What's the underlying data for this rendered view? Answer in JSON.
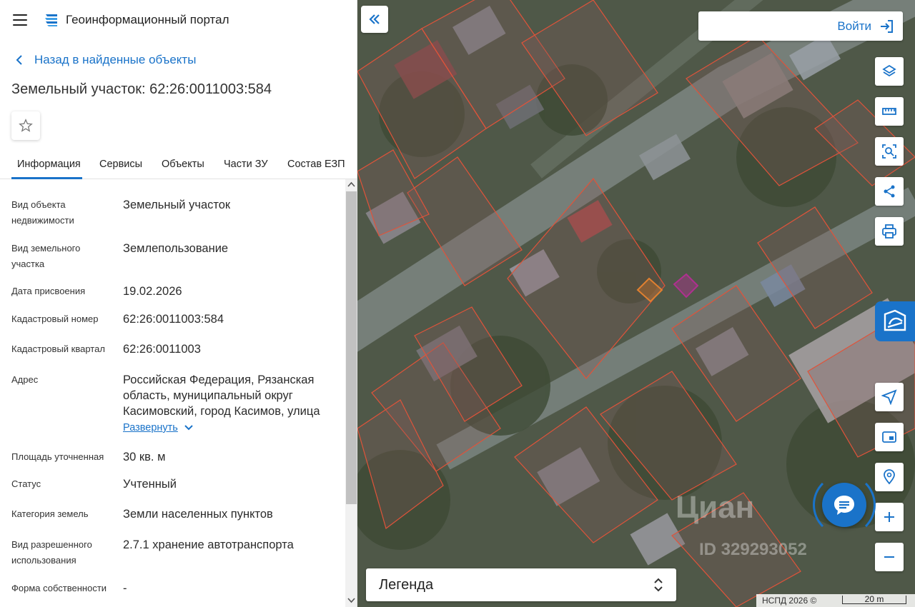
{
  "header": {
    "portal_title": "Геоинформационный портал",
    "back_label": "Назад в найденные объекты",
    "object_title": "Земельный участок: 62:26:0011003:584"
  },
  "tabs": [
    {
      "label": "Информация",
      "active": true
    },
    {
      "label": "Сервисы"
    },
    {
      "label": "Объекты"
    },
    {
      "label": "Части ЗУ"
    },
    {
      "label": "Состав ЕЗП"
    }
  ],
  "info": {
    "rows": [
      {
        "label": "Вид объекта недвижимости",
        "value": "Земельный участок"
      },
      {
        "label": "Вид земельного участка",
        "value": "Землепользование"
      },
      {
        "label": "Дата присвоения",
        "value": "19.02.2026"
      },
      {
        "label": "Кадастровый номер",
        "value": "62:26:0011003:584"
      },
      {
        "label": "Кадастровый квартал",
        "value": "62:26:0011003"
      },
      {
        "label": "Адрес",
        "value": "Российская Федерация, Рязанская область, муниципальный округ Касимовский, город Касимов, улица"
      },
      {
        "label": "Площадь уточненная",
        "value": "30 кв. м"
      },
      {
        "label": "Статус",
        "value": "Учтенный"
      },
      {
        "label": "Категория земель",
        "value": "Земли населенных пунктов"
      },
      {
        "label": "Вид разрешенного использования",
        "value": "2.7.1 хранение автотранспорта"
      },
      {
        "label": "Форма собственности",
        "value": "-"
      }
    ],
    "expand_label": "Развернуть"
  },
  "map": {
    "login_label": "Войти",
    "legend_label": "Легенда",
    "attribution": "НСПД 2026 ©",
    "scale_label": "20 m",
    "watermark": "Циан",
    "watermark_id": "ID 329293052",
    "tools": [
      "layers-icon",
      "ruler-icon",
      "select-area-icon",
      "share-icon",
      "print-icon"
    ],
    "nav_tools": [
      "locate-icon",
      "minimap-icon",
      "search-location-icon",
      "zoom-in-icon",
      "zoom-out-icon"
    ]
  },
  "colors": {
    "accent": "#1a73c9",
    "parcel_line": "#e0533a",
    "highlight": "#b03090"
  }
}
